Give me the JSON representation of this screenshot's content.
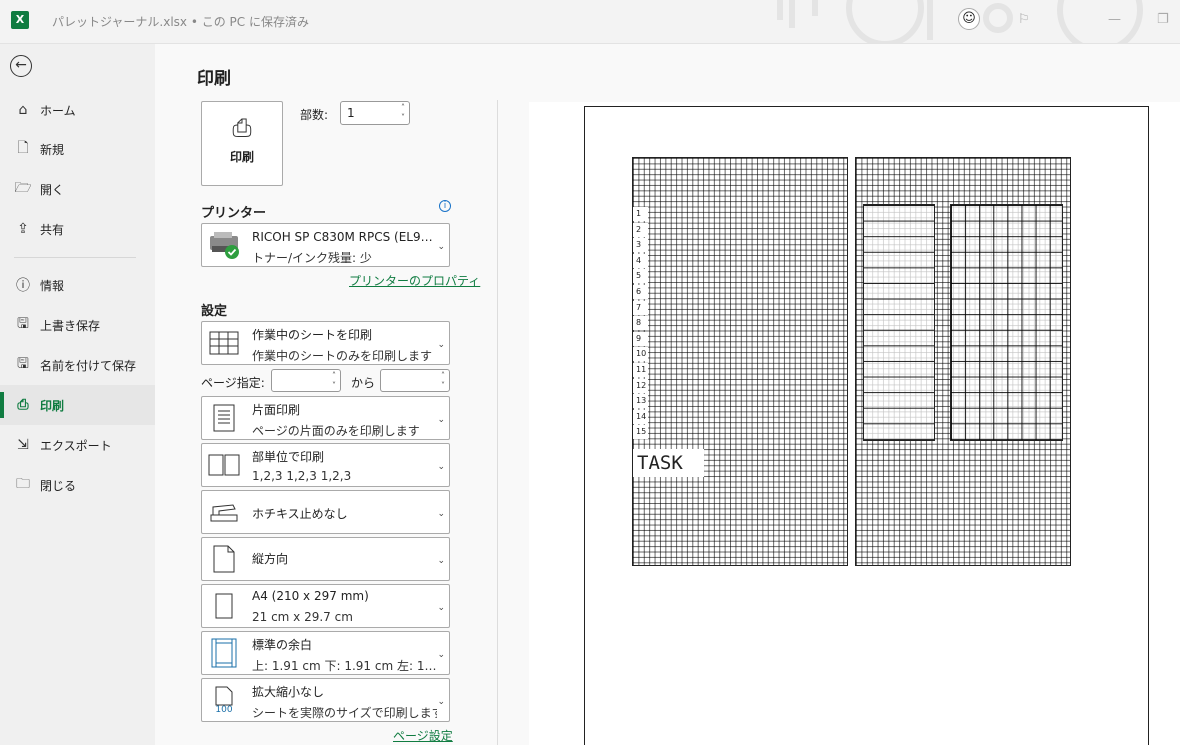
{
  "window": {
    "title": "パレットジャーナル.xlsx • この PC に保存済み",
    "app_icon": "X"
  },
  "nav": {
    "items": [
      {
        "label": "ホーム",
        "icon": "home-icon"
      },
      {
        "label": "新規",
        "icon": "new-document-icon"
      },
      {
        "label": "開く",
        "icon": "folder-open-icon"
      },
      {
        "label": "共有",
        "icon": "share-icon"
      },
      {
        "label": "情報",
        "icon": "info-icon"
      },
      {
        "label": "上書き保存",
        "icon": "save-icon"
      },
      {
        "label": "名前を付けて保存",
        "icon": "save-as-icon"
      },
      {
        "label": "印刷",
        "icon": "printer-icon"
      },
      {
        "label": "エクスポート",
        "icon": "export-icon"
      },
      {
        "label": "閉じる",
        "icon": "close-folder-icon"
      }
    ],
    "active": "印刷"
  },
  "print": {
    "title": "印刷",
    "button_label": "印刷",
    "copies_label": "部数:",
    "copies_value": "1",
    "printer_heading": "プリンター",
    "printer_name": "RICOH SP C830M RPCS (EL9…",
    "printer_status": "トナー/インク残量: 少",
    "printer_properties_link": "プリンターのプロパティ",
    "settings_heading": "設定",
    "what_to_print": {
      "l1": "作業中のシートを印刷",
      "l2": "作業中のシートのみを印刷します"
    },
    "page_range_label": "ページ指定:",
    "page_range_from": "",
    "page_range_sep": "から",
    "page_range_to": "",
    "sides": {
      "l1": "片面印刷",
      "l2": "ページの片面のみを印刷します"
    },
    "collation": {
      "l1": "部単位で印刷",
      "l2": "1,2,3    1,2,3    1,2,3"
    },
    "staple": {
      "l1": "ホチキス止めなし"
    },
    "orientation": {
      "l1": "縦方向"
    },
    "paper": {
      "l1": "A4 (210 x 297 mm)",
      "l2": "21 cm x 29.7 cm"
    },
    "margins": {
      "l1": "標準の余白",
      "l2": "上: 1.91 cm 下: 1.91 cm 左: 1…"
    },
    "scaling": {
      "l1": "拡大縮小なし",
      "l2": "シートを実際のサイズで印刷します",
      "icon_text": "100"
    },
    "page_setup_link": "ページ設定"
  },
  "preview": {
    "row_numbers": [
      "1",
      "2",
      "3",
      "4",
      "5",
      "6",
      "7",
      "8",
      "9",
      "10",
      "11",
      "12",
      "13",
      "14",
      "15"
    ],
    "task_label": "TASK"
  },
  "colors": {
    "accent": "#107c41",
    "link": "#107c41"
  }
}
